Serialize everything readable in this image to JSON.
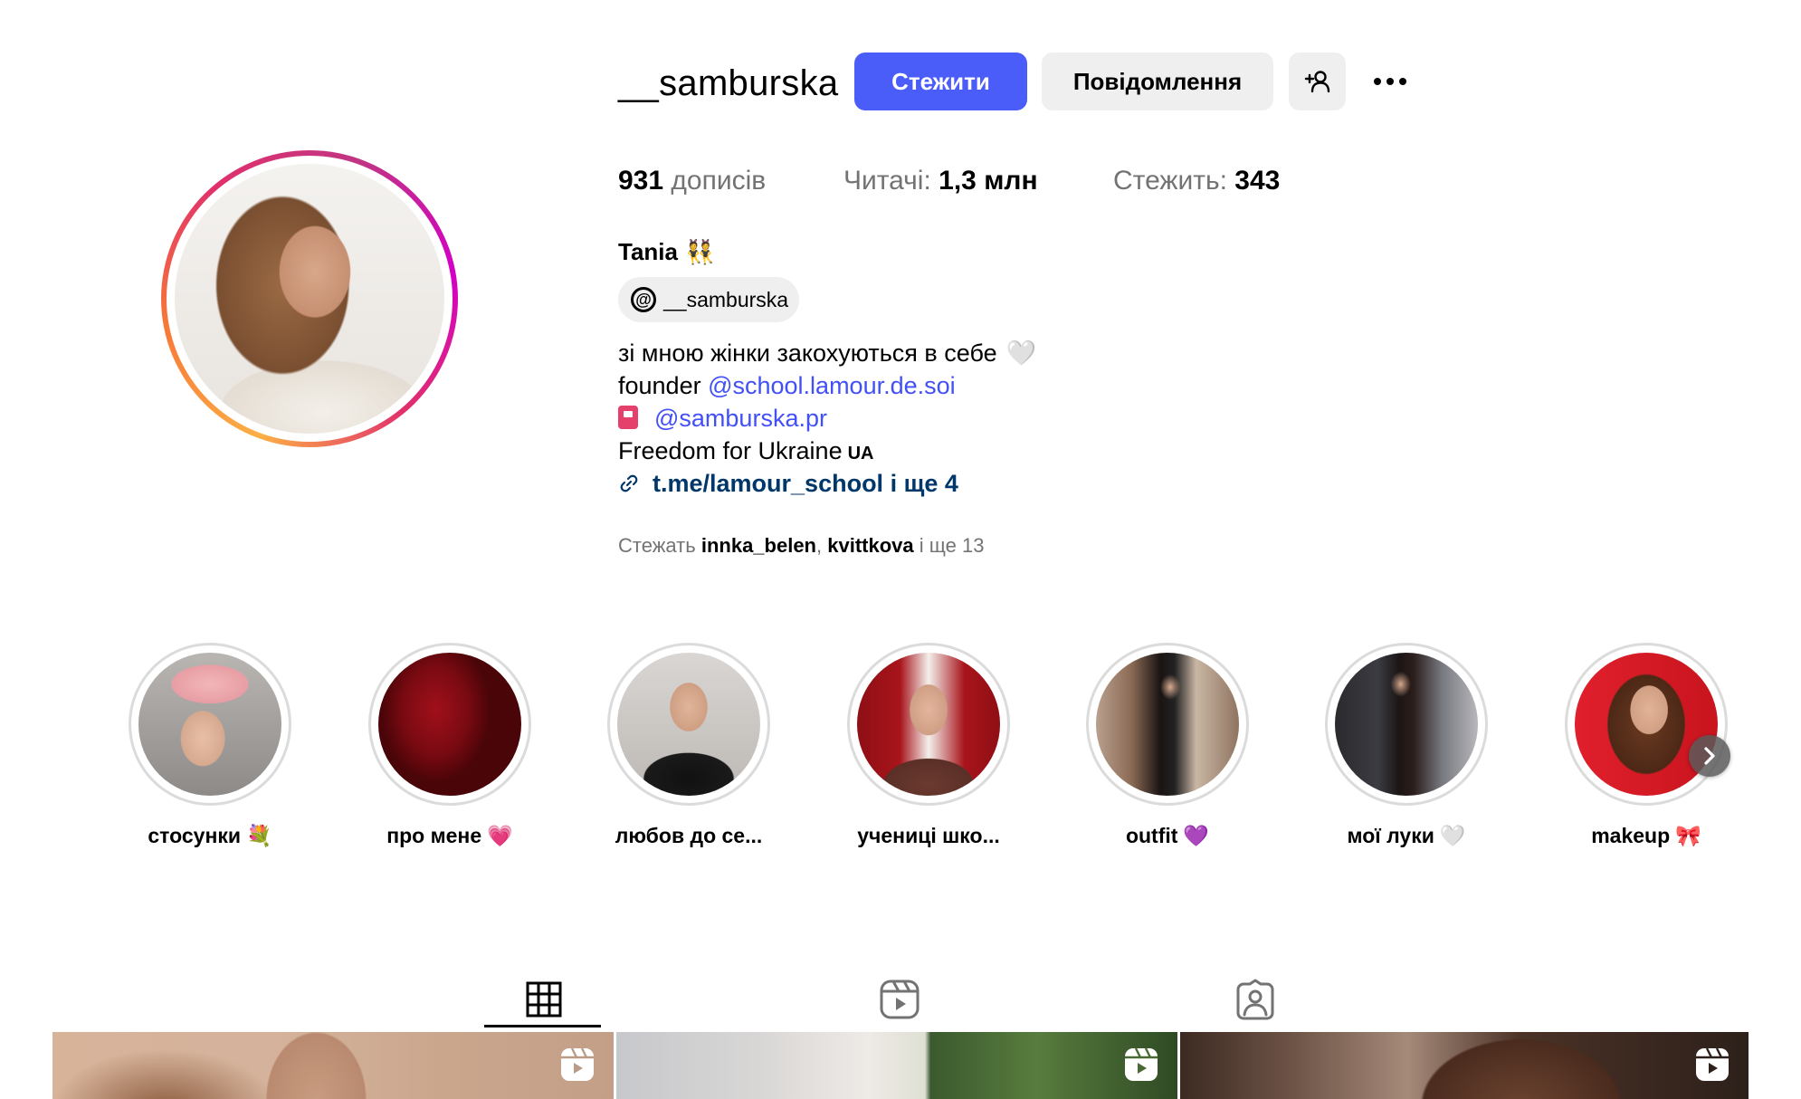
{
  "header": {
    "username": "__samburska",
    "follow_label": "Стежити",
    "message_label": "Повідомлення",
    "add_user_icon": "person-plus-icon",
    "more_icon": "more-dots-icon"
  },
  "stats": {
    "posts_value": "931",
    "posts_label": "дописів",
    "followers_label": "Читачі:",
    "followers_value": "1,3 млн",
    "following_label": "Стежить:",
    "following_value": "343"
  },
  "bio": {
    "full_name": "Tania",
    "full_name_emoji": "👯",
    "threads_handle": "__samburska",
    "line1": "зі мною жінки закохуються в себе",
    "line1_emoji": "🤍",
    "line2_prefix": "founder",
    "line2_mention": "@school.lamour.de.soi",
    "line3_mention": "@samburska.pr",
    "line4": "Freedom for Ukraine",
    "line4_flag": "UA",
    "link_text": "t.me/lamour_school і ще 4"
  },
  "followed_by": {
    "prefix": "Стежать",
    "user1": "innka_belen",
    "separator": ",",
    "user2": "kvittkova",
    "suffix": "і ще 13"
  },
  "highlights": [
    {
      "label": "стосунки",
      "emoji": "💐"
    },
    {
      "label": "про мене",
      "emoji": "💗"
    },
    {
      "label": "любов до се...",
      "emoji": ""
    },
    {
      "label": "учениці шко...",
      "emoji": ""
    },
    {
      "label": "outfit",
      "emoji": "💜"
    },
    {
      "label": "мої луки",
      "emoji": "🤍"
    },
    {
      "label": "makeup",
      "emoji": "🎀"
    }
  ],
  "tabs": {
    "posts_icon": "grid-icon",
    "reels_icon": "reels-icon",
    "tagged_icon": "tagged-person-icon"
  },
  "colors": {
    "accent": "#4a5df9",
    "link": "#4150f7",
    "link_dark": "#00376b",
    "muted": "#737373",
    "chip_bg": "#efefef"
  }
}
